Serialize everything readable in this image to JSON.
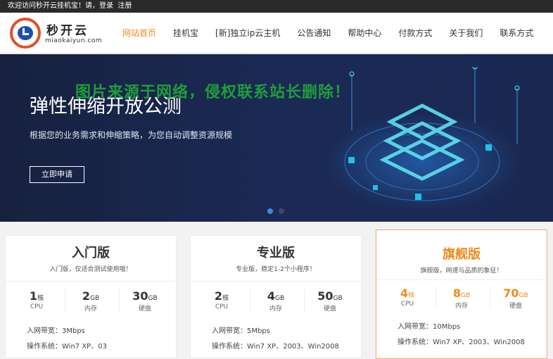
{
  "topbar": {
    "welcome": "欢迎访问秒开云挂机宝！请，",
    "login": "登录",
    "register": "注册"
  },
  "logo": {
    "cn": "秒开云",
    "en": "miaokaiyun.com"
  },
  "nav": [
    "网站首页",
    "挂机宝",
    "[新]独立ip云主机",
    "公告通知",
    "帮助中心",
    "付款方式",
    "关于我们",
    "联系方式"
  ],
  "banner": {
    "title": "弹性伸缩开放公测",
    "subtitle": "根据您的业务需求和伸缩策略，为您自动调整资源规模",
    "button": "立即申请",
    "watermark": "图片来源于网络，侵权联系站长删除！"
  },
  "colors": {
    "accent": "#f08a1c",
    "banner_bg": "#1b2a55",
    "watermark": "#1f9d3a"
  },
  "plans": [
    {
      "name": "入门版",
      "desc": "入门版，仅适合测试使用哦！",
      "specs": [
        {
          "value": "1",
          "unit": "核",
          "label": "CPU"
        },
        {
          "value": "2",
          "unit": "GB",
          "label": "内存"
        },
        {
          "value": "30",
          "unit": "GB",
          "label": "硬盘"
        }
      ],
      "lines": [
        "入网带宽：3Mbps",
        "操作系统：Win7 XP、03"
      ]
    },
    {
      "name": "专业版",
      "desc": "专业版，稳定1-2个小程序！",
      "specs": [
        {
          "value": "2",
          "unit": "核",
          "label": "CPU"
        },
        {
          "value": "4",
          "unit": "GB",
          "label": "内存"
        },
        {
          "value": "50",
          "unit": "GB",
          "label": "硬盘"
        }
      ],
      "lines": [
        "入网带宽：5Mbps",
        "操作系统：Win7 XP、2003、Win2008"
      ]
    },
    {
      "name": "旗舰版",
      "desc": "旗舰版，网速与品质的象征！",
      "specs": [
        {
          "value": "4",
          "unit": "核",
          "label": "CPU"
        },
        {
          "value": "8",
          "unit": "GB",
          "label": "内存"
        },
        {
          "value": "70",
          "unit": "GB",
          "label": "硬盘"
        }
      ],
      "lines": [
        "入网带宽：10Mbps",
        "操作系统：Win7 XP、2003、Win2008"
      ]
    }
  ]
}
